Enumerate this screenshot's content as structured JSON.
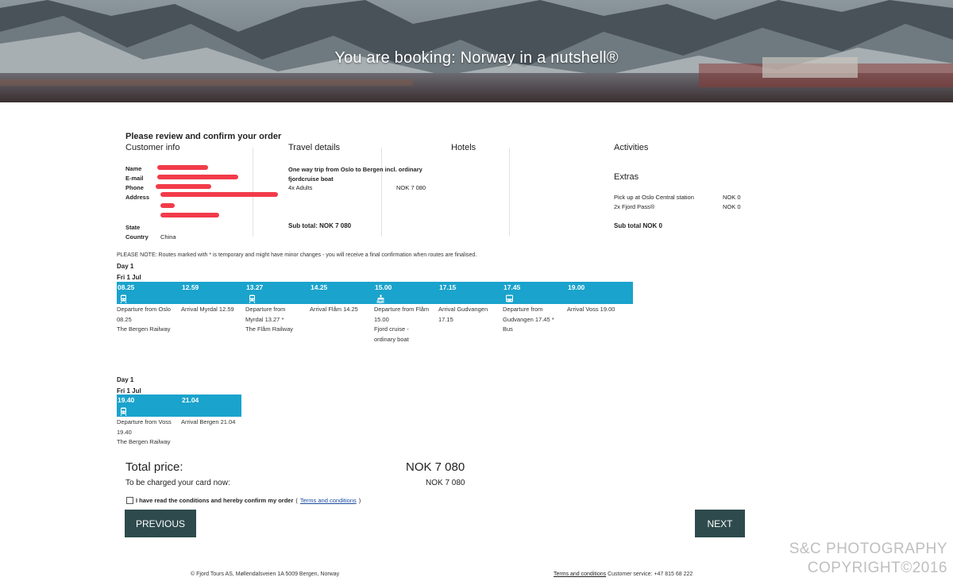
{
  "hero": {
    "title": "You are booking: Norway in a nutshell®"
  },
  "review": {
    "title": "Please review and confirm your order",
    "columns": {
      "customer": "Customer info",
      "travel": "Travel details",
      "hotels": "Hotels",
      "activities": "Activities"
    }
  },
  "customer": {
    "name_label": "Name",
    "email_label": "E-mail",
    "phone_label": "Phone",
    "address_label": "Address",
    "state_label": "State",
    "country_label": "Country",
    "country_value": "China"
  },
  "travel": {
    "trip": "One way trip from Oslo to Bergen incl. ordinary fjordcruise boat",
    "adults": "4x Adults",
    "adults_price": "NOK  7 080",
    "subtotal": "Sub total: NOK  7 080"
  },
  "activities": {
    "extras_title": "Extras",
    "items": [
      {
        "label": "Pick up at Oslo Central station",
        "price": "NOK  0"
      },
      {
        "label": "2x Fjord Pass®",
        "price": "NOK  0"
      }
    ],
    "subtotal": "Sub total NOK  0"
  },
  "note": "PLEASE NOTE: Routes marked with * is temporary and might have minor changes - you will receive a final confirmation when routes are finalised.",
  "journey1": {
    "day": "Day 1",
    "date": "Fri 1 Jul",
    "times": [
      "08.25",
      "12.59",
      "13.27",
      "14.25",
      "15.00",
      "17.15",
      "17.45",
      "19.00"
    ],
    "icons": [
      "train-icon",
      "",
      "train-icon",
      "",
      "boat-icon",
      "",
      "bus-icon",
      ""
    ],
    "descs": [
      [
        "Departure from Oslo",
        "08.25",
        "The Bergen Railway"
      ],
      [
        "Arrival Myrdal 12.59"
      ],
      [
        "Departure from",
        "Myrdal 13.27 *",
        "The Flåm Railway"
      ],
      [
        "Arrival Flåm 14.25"
      ],
      [
        "Departure from Flåm",
        "15.00",
        "Fjord cruise -",
        "ordinary boat"
      ],
      [
        "Arrival Gudvangen",
        "17.15"
      ],
      [
        "Departure from",
        "Gudvangen 17.45 *",
        "Bus"
      ],
      [
        "Arrival Voss 19.00"
      ]
    ]
  },
  "journey2": {
    "day": "Day 1",
    "date": "Fri 1 Jul",
    "times": [
      "19.40",
      "21.04"
    ],
    "icons": [
      "train-icon",
      ""
    ],
    "descs": [
      [
        "Departure from Voss",
        "19.40",
        "The Bergen Railway"
      ],
      [
        "Arrival Bergen 21.04"
      ]
    ]
  },
  "totals": {
    "total_label": "Total price:",
    "total_value": "NOK 7 080",
    "charge_label": "To be charged your card now:",
    "charge_value": "NOK 7 080"
  },
  "confirm": {
    "text": "I have read the conditions and hereby confirm my order",
    "paren_open": "(",
    "link": "Terms and conditions",
    "paren_close": ")"
  },
  "buttons": {
    "previous": "PREVIOUS",
    "next": "NEXT"
  },
  "footer": {
    "company": "© Fjord Tours AS, Møllendalsveien 1A 5009 Bergen, Norway",
    "terms": "Terms and conditions",
    "service": " Customer service: +47 815 68 222"
  },
  "watermark": {
    "line1": "S&C PHOTOGRAPHY",
    "line2": "COPYRIGHT©2016"
  },
  "colors": {
    "timeline": "#1aa3cc",
    "button": "#2e4a4c",
    "redaction": "#f23b4a"
  }
}
